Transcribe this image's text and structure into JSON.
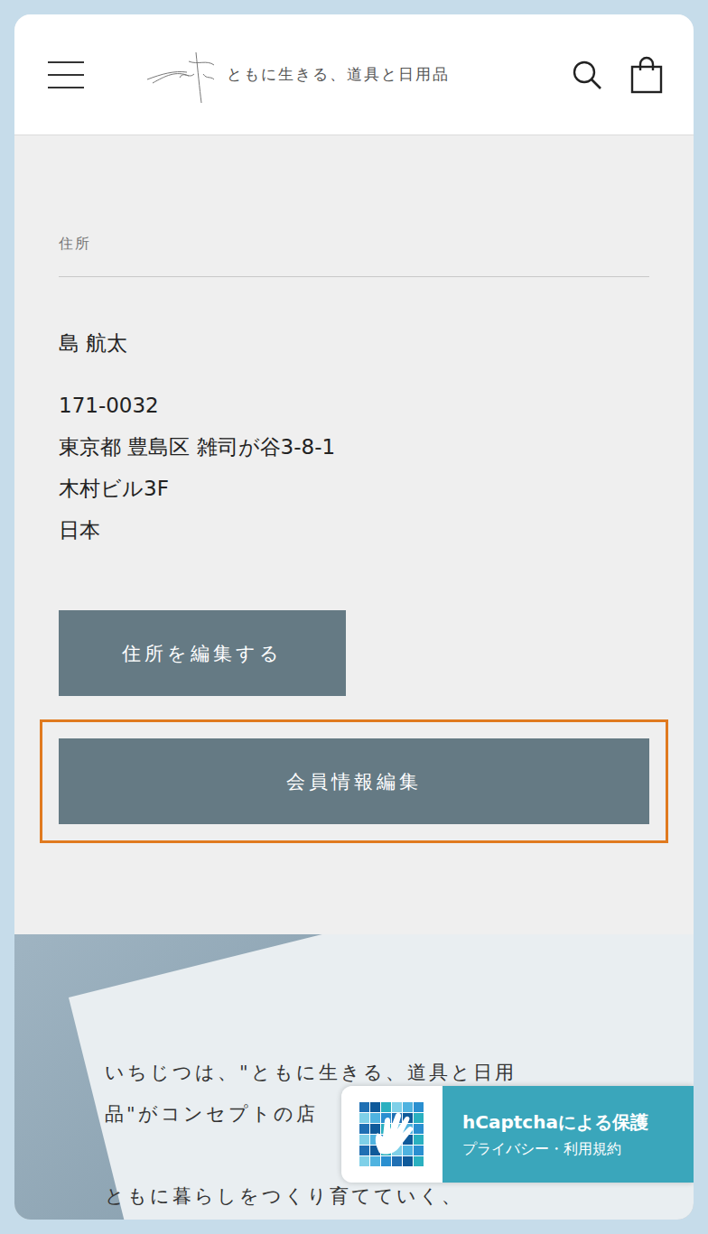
{
  "header": {
    "logo_text": "ともに生きる、道具と日用品"
  },
  "address": {
    "section_label": "住所",
    "name": "島 航太",
    "lines": [
      "171-0032",
      "東京都 豊島区 雑司が谷3-8-1",
      "木村ビル3F",
      "日本"
    ]
  },
  "buttons": [
    {
      "label": "住所を編集する",
      "highlighted": false
    },
    {
      "label": "会員情報編集",
      "highlighted": true
    }
  ],
  "hero": {
    "paragraphs": [
      [
        "いちじつは、\"ともに生きる、道具と日用",
        "品\"がコンセプトの店"
      ],
      [
        "ともに暮らしをつくり育てていく、"
      ]
    ]
  },
  "captcha_badge": {
    "title": "hCaptchaによる保護",
    "links": "プライバシー・利用規約"
  }
}
